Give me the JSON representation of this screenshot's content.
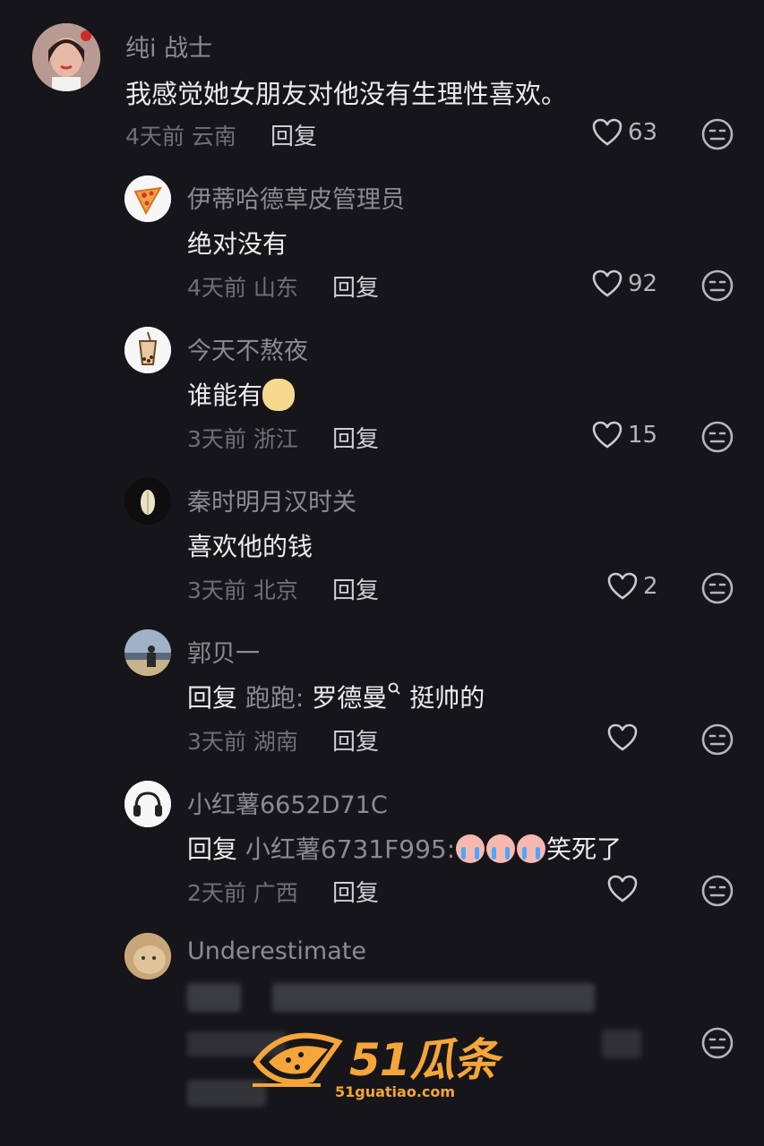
{
  "comments": [
    {
      "user": "纯i 战士",
      "text": "我感觉她女朋友对他没有生理性喜欢。",
      "time": "4天前",
      "location": "云南",
      "reply": "回复",
      "likes": "63"
    },
    {
      "user": "伊蒂哈德草皮管理员",
      "text": "绝对没有",
      "time": "4天前",
      "location": "山东",
      "reply": "回复",
      "likes": "92"
    },
    {
      "user": "今天不熬夜",
      "text": "谁能有",
      "time": "3天前",
      "location": "浙江",
      "reply": "回复",
      "likes": "15"
    },
    {
      "user": "秦时明月汉时关",
      "text": "喜欢他的钱",
      "time": "3天前",
      "location": "北京",
      "reply": "回复",
      "likes": "2"
    },
    {
      "user": "郭贝一",
      "reply_prefix": "回复",
      "reply_to": "跑跑:",
      "text": "罗德曼",
      "text_after": "挺帅的",
      "time": "3天前",
      "location": "湖南",
      "reply": "回复",
      "likes": ""
    },
    {
      "user": "小红薯6652D71C",
      "reply_prefix": "回复",
      "reply_to": "小红薯6731F995:",
      "text": "笑死了",
      "time": "2天前",
      "location": "广西",
      "reply": "回复",
      "likes": ""
    },
    {
      "user": "Underestimate"
    }
  ],
  "watermark": {
    "brand": "51瓜条",
    "url": "51guatiao.com"
  },
  "colors": {
    "background": "#16161a",
    "watermark": "#f5a53a"
  }
}
